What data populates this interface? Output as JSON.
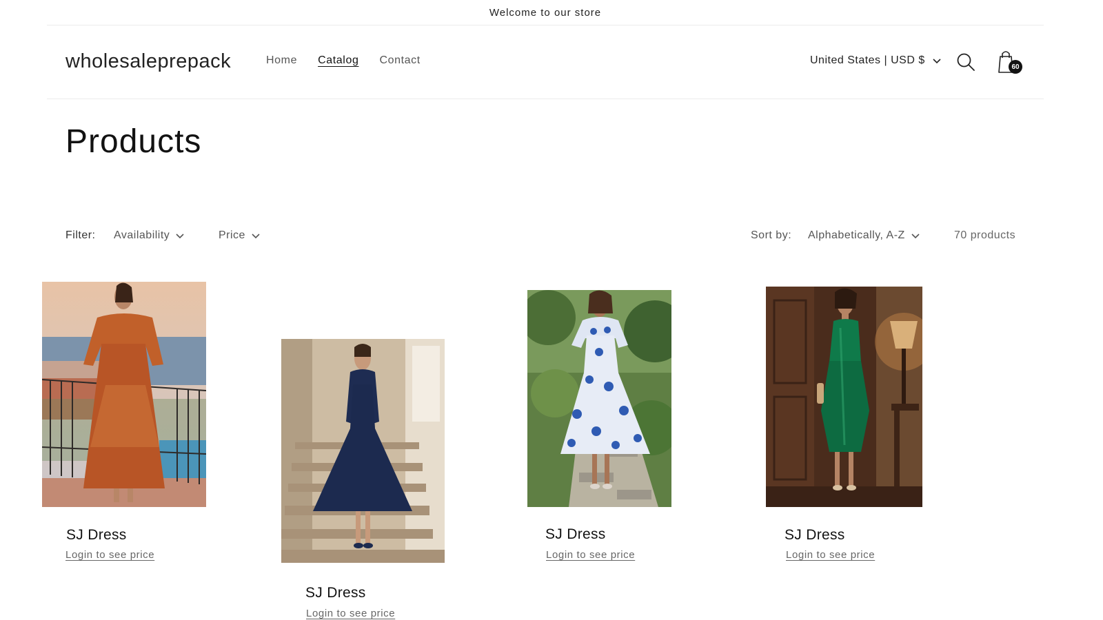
{
  "announcement": {
    "text": "Welcome to our store"
  },
  "header": {
    "logo": "wholesaleprepack",
    "nav": [
      {
        "label": "Home",
        "active": false
      },
      {
        "label": "Catalog",
        "active": true
      },
      {
        "label": "Contact",
        "active": false
      }
    ],
    "country": "United States | USD $",
    "cart_count": "60"
  },
  "page": {
    "title": "Products"
  },
  "filters": {
    "label": "Filter:",
    "availability": "Availability",
    "price": "Price",
    "sort_label": "Sort by:",
    "sort_value": "Alphabetically, A-Z",
    "count": "70 products"
  },
  "products": [
    {
      "title": "SJ Dress",
      "price_text": "Login to see price"
    },
    {
      "title": "SJ Dress",
      "price_text": "Login to see price"
    },
    {
      "title": "SJ Dress",
      "price_text": "Login to see price"
    },
    {
      "title": "SJ Dress",
      "price_text": "Login to see price"
    }
  ]
}
